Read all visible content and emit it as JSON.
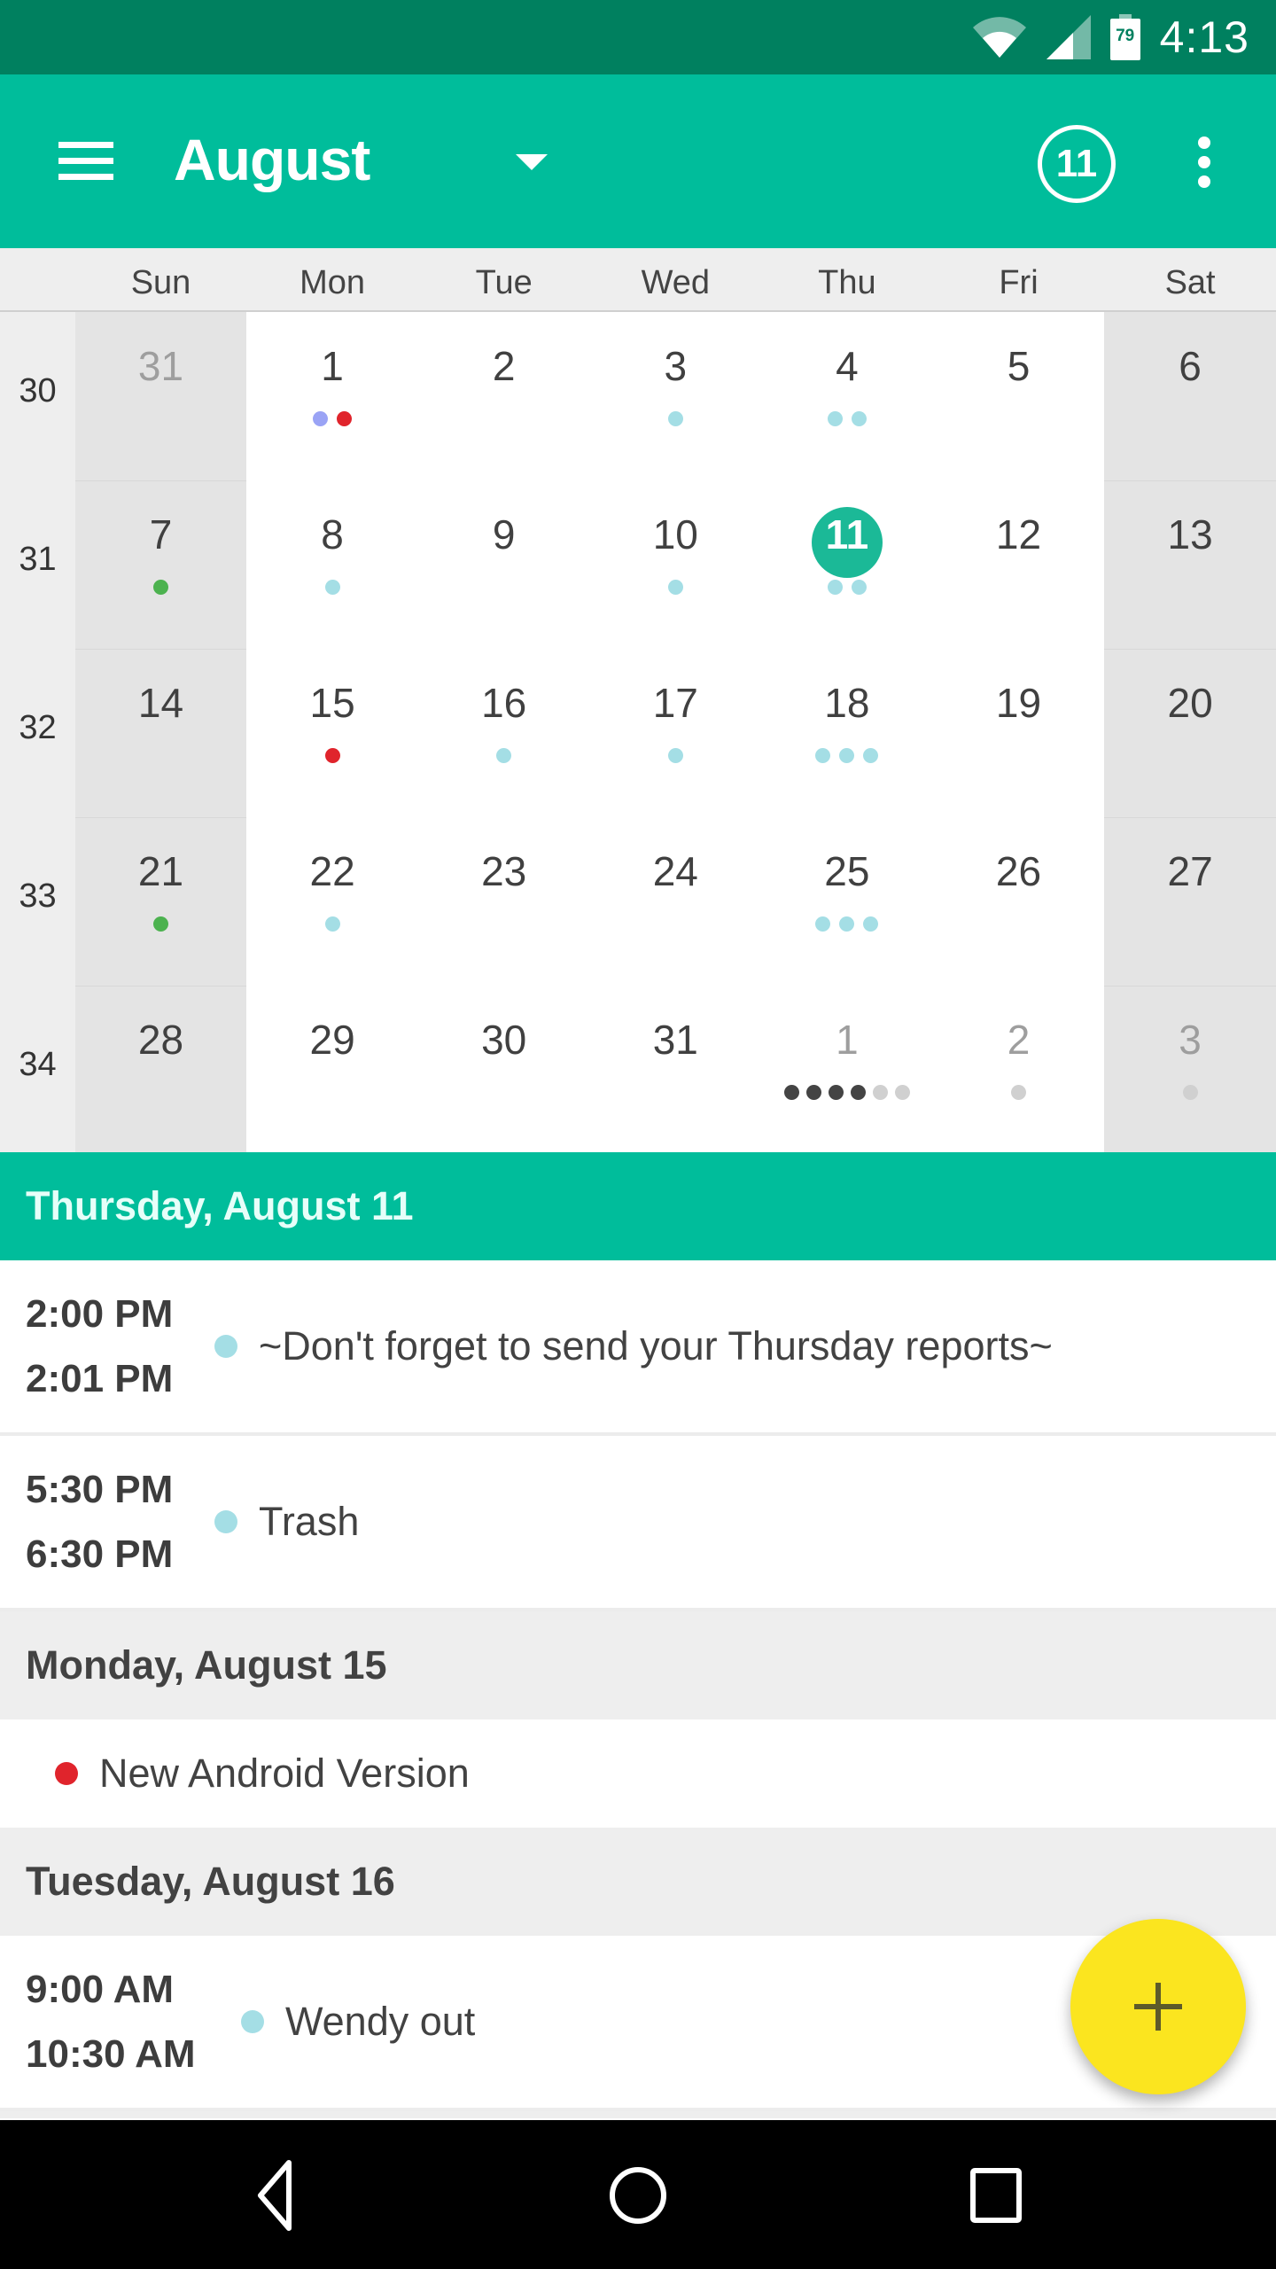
{
  "status_bar": {
    "time": "4:13",
    "battery_level": "79",
    "icons": [
      "wifi-icon",
      "cell-signal-icon",
      "battery-icon"
    ]
  },
  "app_bar": {
    "title": "August",
    "today_label": "11",
    "icons": [
      "menu-icon",
      "dropdown-icon",
      "today-icon",
      "more-vert-icon"
    ],
    "color": "#00bd9b"
  },
  "calendar": {
    "weekdays": [
      "Sun",
      "Mon",
      "Tue",
      "Wed",
      "Thu",
      "Fri",
      "Sat"
    ],
    "weeks": [
      {
        "num": "30",
        "days": [
          {
            "d": "31",
            "other": true,
            "dots": []
          },
          {
            "d": "1",
            "dots": [
              "#9aa3f5",
              "#e0242c"
            ]
          },
          {
            "d": "2",
            "dots": []
          },
          {
            "d": "3",
            "dots": [
              "#a4dee5"
            ]
          },
          {
            "d": "4",
            "dots": [
              "#a4dee5",
              "#a4dee5"
            ]
          },
          {
            "d": "5",
            "dots": []
          },
          {
            "d": "6",
            "dots": []
          }
        ]
      },
      {
        "num": "31",
        "days": [
          {
            "d": "7",
            "dots": [
              "#4cb24f"
            ]
          },
          {
            "d": "8",
            "dots": [
              "#a4dee5"
            ]
          },
          {
            "d": "9",
            "dots": []
          },
          {
            "d": "10",
            "dots": [
              "#a4dee5"
            ]
          },
          {
            "d": "11",
            "today": true,
            "dots": [
              "#a4dee5",
              "#a4dee5"
            ]
          },
          {
            "d": "12",
            "dots": []
          },
          {
            "d": "13",
            "dots": []
          }
        ]
      },
      {
        "num": "32",
        "days": [
          {
            "d": "14",
            "dots": []
          },
          {
            "d": "15",
            "dots": [
              "#e0242c"
            ]
          },
          {
            "d": "16",
            "dots": [
              "#a4dee5"
            ]
          },
          {
            "d": "17",
            "dots": [
              "#a4dee5"
            ]
          },
          {
            "d": "18",
            "dots": [
              "#a4dee5",
              "#a4dee5",
              "#a4dee5"
            ]
          },
          {
            "d": "19",
            "dots": []
          },
          {
            "d": "20",
            "dots": []
          }
        ]
      },
      {
        "num": "33",
        "days": [
          {
            "d": "21",
            "dots": [
              "#4cb24f"
            ]
          },
          {
            "d": "22",
            "dots": [
              "#a4dee5"
            ]
          },
          {
            "d": "23",
            "dots": []
          },
          {
            "d": "24",
            "dots": []
          },
          {
            "d": "25",
            "dots": [
              "#a4dee5",
              "#a4dee5",
              "#a4dee5"
            ]
          },
          {
            "d": "26",
            "dots": []
          },
          {
            "d": "27",
            "dots": []
          }
        ]
      },
      {
        "num": "34",
        "days": [
          {
            "d": "28",
            "dots": []
          },
          {
            "d": "29",
            "dots": []
          },
          {
            "d": "30",
            "dots": []
          },
          {
            "d": "31",
            "dots": []
          },
          {
            "d": "1",
            "other": true,
            "dots": [
              "#444444",
              "#444444",
              "#444444",
              "#444444",
              "#d0d0d0",
              "#d0d0d0"
            ]
          },
          {
            "d": "2",
            "other": true,
            "dots": [
              "#d0d0d0"
            ]
          },
          {
            "d": "3",
            "other": true,
            "dots": [
              "#d0d0d0"
            ]
          }
        ]
      }
    ]
  },
  "agenda": {
    "sections": [
      {
        "header": "Thursday, August 11",
        "active": true,
        "events": [
          {
            "start": "2:00 PM",
            "end": "2:01 PM",
            "title": "~Don't forget to send your Thursday reports~",
            "color": "#a4dee5"
          },
          {
            "start": "5:30 PM",
            "end": "6:30 PM",
            "title": "Trash",
            "color": "#a4dee5"
          }
        ]
      },
      {
        "header": "Monday, August 15",
        "active": false,
        "events": [
          {
            "all_day": true,
            "title": "New Android Version",
            "color": "#e0242c"
          }
        ]
      },
      {
        "header": "Tuesday, August 16",
        "active": false,
        "events": [
          {
            "start": "9:00 AM",
            "end": "10:30 AM",
            "title": "Wendy out",
            "color": "#a4dee5"
          }
        ]
      }
    ]
  },
  "fab": {
    "icon": "add-icon",
    "color": "#fbe51f"
  },
  "nav_bar": {
    "buttons": [
      "back-icon",
      "home-icon",
      "recents-icon"
    ]
  }
}
